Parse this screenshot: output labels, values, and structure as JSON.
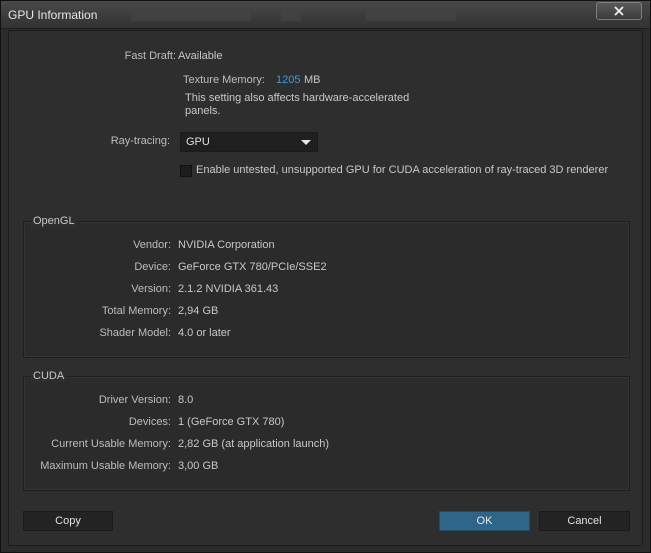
{
  "window": {
    "title": "GPU Information"
  },
  "general": {
    "fast_draft_label": "Fast Draft:",
    "fast_draft_value": "Available",
    "texture_memory_label": "Texture Memory:",
    "texture_memory_value": "1205",
    "texture_memory_unit": "MB",
    "note_line1": "This setting also affects hardware-accelerated",
    "note_line2": "panels.",
    "raytracing_label": "Ray-tracing:",
    "raytracing_value": "GPU",
    "untested_checkbox_label": "Enable untested, unsupported GPU for CUDA acceleration of ray-traced 3D renderer",
    "untested_checked": false
  },
  "opengl": {
    "title": "OpenGL",
    "rows": [
      {
        "label": "Vendor:",
        "value": "NVIDIA Corporation"
      },
      {
        "label": "Device:",
        "value": "GeForce GTX 780/PCIe/SSE2"
      },
      {
        "label": "Version:",
        "value": "2.1.2 NVIDIA 361.43"
      },
      {
        "label": "Total Memory:",
        "value": "2,94 GB"
      },
      {
        "label": "Shader Model:",
        "value": "4.0 or later"
      }
    ]
  },
  "cuda": {
    "title": "CUDA",
    "rows": [
      {
        "label": "Driver Version:",
        "value": "8.0"
      },
      {
        "label": "Devices:",
        "value": "1 (GeForce GTX 780)"
      },
      {
        "label": "Current Usable Memory:",
        "value": "2,82 GB (at application launch)"
      },
      {
        "label": "Maximum Usable Memory:",
        "value": "3,00 GB"
      }
    ]
  },
  "buttons": {
    "copy": "Copy",
    "ok": "OK",
    "cancel": "Cancel"
  },
  "colors": {
    "accent": "#2f6589",
    "highlight": "#3f9ad6"
  }
}
